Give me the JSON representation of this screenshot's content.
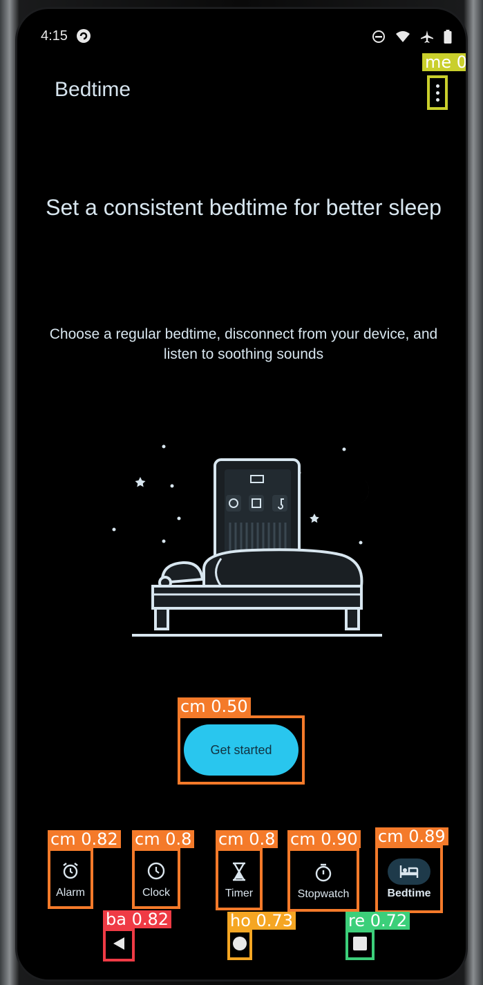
{
  "status_bar": {
    "time": "4:15"
  },
  "app_bar": {
    "title": "Bedtime"
  },
  "main": {
    "headline": "Set a consistent bedtime for better sleep",
    "subtext": "Choose a regular bedtime, disconnect from your device, and listen to soothing sounds",
    "cta_label": "Get started"
  },
  "bottom_nav": {
    "items": [
      {
        "label": "Alarm",
        "icon": "alarm-clock-icon"
      },
      {
        "label": "Clock",
        "icon": "clock-icon"
      },
      {
        "label": "Timer",
        "icon": "hourglass-icon"
      },
      {
        "label": "Stopwatch",
        "icon": "stopwatch-icon"
      },
      {
        "label": "Bedtime",
        "icon": "bed-icon",
        "selected": true
      }
    ]
  },
  "detections": {
    "menu": "me  0",
    "cta": "cm  0.50",
    "alarm": "cm  0.82",
    "clock": "cm  0.8",
    "timer": "cm  0.8",
    "stopwatch": "cm  0.90",
    "bedtime": "cm  0.89",
    "back": "ba  0.82",
    "home": "ho  0.73",
    "recents": "re  0.72"
  },
  "colors": {
    "accent": "#29c6ee",
    "detection_orange": "#f47a2a",
    "detection_yellow": "#c9cf2c",
    "detection_red": "#ef3b45",
    "detection_amber": "#f5a623",
    "detection_green": "#3ccf7a"
  }
}
